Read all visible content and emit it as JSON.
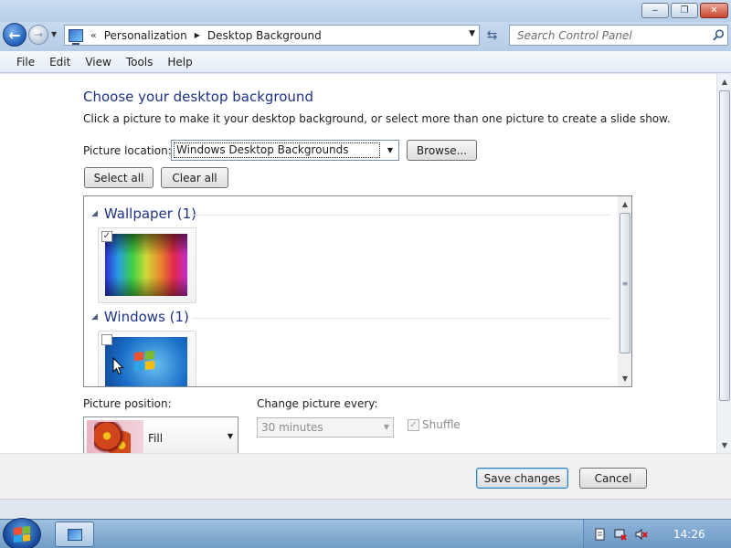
{
  "window": {
    "caption_min": "‒",
    "caption_max": "❐",
    "caption_close": "✕"
  },
  "address_bar": {
    "chevron": "«",
    "breadcrumbs": [
      "Personalization",
      "Desktop Background"
    ],
    "separator": "▶"
  },
  "search": {
    "placeholder": "Search Control Panel"
  },
  "menu": [
    "File",
    "Edit",
    "View",
    "Tools",
    "Help"
  ],
  "main": {
    "title": "Choose your desktop background",
    "description": "Click a picture to make it your desktop background, or select more than one picture to create a slide show.",
    "picture_location_label": "Picture location:",
    "picture_location_value": "Windows Desktop Backgrounds",
    "browse_label": "Browse...",
    "select_all_label": "Select all",
    "clear_all_label": "Clear all",
    "groups": [
      {
        "name": "Wallpaper (1)",
        "checked": true,
        "thumb": "rainbow-wallpaper"
      },
      {
        "name": "Windows (1)",
        "checked": false,
        "thumb": "windows-7-logo-wallpaper"
      }
    ],
    "picture_position_label": "Picture position:",
    "picture_position_value": "Fill",
    "change_every_label": "Change picture every:",
    "change_every_value": "30 minutes",
    "shuffle_label": "Shuffle",
    "shuffle_checked": true
  },
  "footer": {
    "save_label": "Save changes",
    "cancel_label": "Cancel"
  },
  "taskbar": {
    "clock": "14:26"
  },
  "icons": {
    "back": "back-arrow-icon",
    "forward": "forward-arrow-icon",
    "search": "search-icon",
    "refresh": "refresh-icon",
    "tray": [
      "action-center-icon",
      "network-disconnected-icon",
      "volume-muted-icon"
    ]
  },
  "colors": {
    "heading": "#1e3287",
    "titlebar": "#c9dcf0",
    "taskbar": "#6f9cc6"
  }
}
